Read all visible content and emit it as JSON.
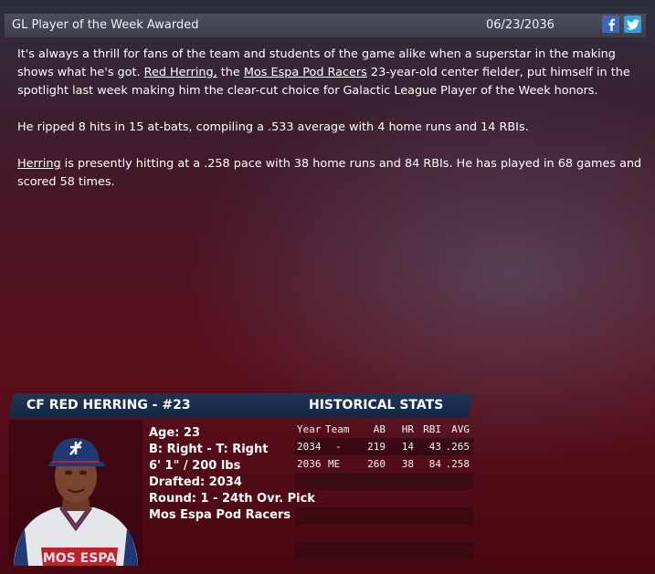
{
  "header": {
    "title": "GL Player of the Week Awarded",
    "date": "06/23/2036",
    "facebook_icon": "facebook-icon",
    "twitter_icon": "twitter-icon"
  },
  "article": {
    "p1_start": "It's always a thrill for fans of the team and students of the game alike when a superstar in the making shows what he's got.",
    "p1_player_link": "Red Herring,",
    "p1_mid": "the",
    "p1_team_link": "Mos Espa Pod Racers",
    "p1_end": "23-year-old center fielder, put himself in the spotlight last week making him the clear-cut choice for Galactic League Player of the Week honors.",
    "p2": "He ripped 8 hits in 15 at-bats, compiling a .533 average with 4 home runs and 14 RBIs.",
    "p3_link": "Herring",
    "p3_rest": "is presently hitting at a .258 pace with 38 home runs and 84 RBIs. He has played in 68 games and scored 58 times."
  },
  "player": {
    "heading": "CF RED HERRING - #23",
    "age": "Age: 23",
    "bats_throws": "B: Right - T: Right",
    "height_weight": "6' 1\" / 200 lbs",
    "drafted": "Drafted: 2034",
    "round": "Round: 1 - 24th Ovr. Pick",
    "team": "Mos Espa Pod Racers",
    "jersey_text": "MOS ESPA"
  },
  "stats": {
    "heading": "HISTORICAL STATS",
    "columns": [
      "Year",
      "Team",
      "AB",
      "HR",
      "RBI",
      "AVG"
    ],
    "rows": [
      [
        "2034",
        "-",
        "219",
        "14",
        "43",
        ".265"
      ],
      [
        "2036",
        "ME",
        "260",
        "38",
        "84",
        ".258"
      ]
    ]
  },
  "colors": {
    "header_bg": "#44464f",
    "card_head_bg": "#1a3050",
    "facebook": "#3b66c4",
    "twitter": "#2aa3ef"
  }
}
